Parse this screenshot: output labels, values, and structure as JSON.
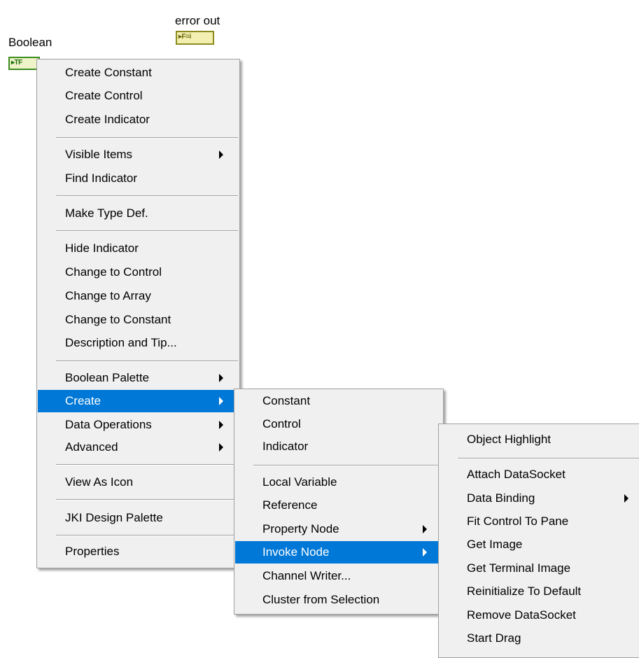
{
  "diagram": {
    "boolean_label": "Boolean",
    "boolean_glyph": "▸TF",
    "error_label": "error out",
    "error_glyph": "▸F≡i"
  },
  "menu1": {
    "items": [
      {
        "label": "Create Constant"
      },
      {
        "label": "Create Control"
      },
      {
        "label": "Create Indicator"
      },
      {
        "label": "Visible Items",
        "submenu": true
      },
      {
        "label": "Find Indicator"
      },
      {
        "label": "Make Type Def."
      },
      {
        "label": "Hide Indicator"
      },
      {
        "label": "Change to Control"
      },
      {
        "label": "Change to Array"
      },
      {
        "label": "Change to Constant"
      },
      {
        "label": "Description and Tip..."
      },
      {
        "label": "Boolean Palette",
        "submenu": true
      },
      {
        "label": "Create",
        "submenu": true,
        "selected": true
      },
      {
        "label": "Data Operations",
        "submenu": true
      },
      {
        "label": "Advanced",
        "submenu": true
      },
      {
        "label": "View As Icon"
      },
      {
        "label": "JKI Design Palette"
      },
      {
        "label": "Properties"
      }
    ]
  },
  "menu2": {
    "items": [
      {
        "label": "Constant"
      },
      {
        "label": "Control"
      },
      {
        "label": "Indicator"
      },
      {
        "label": "Local Variable"
      },
      {
        "label": "Reference"
      },
      {
        "label": "Property Node",
        "submenu": true
      },
      {
        "label": "Invoke Node",
        "submenu": true,
        "selected": true
      },
      {
        "label": "Channel Writer..."
      },
      {
        "label": "Cluster from Selection"
      }
    ]
  },
  "menu3": {
    "items": [
      {
        "label": "Object Highlight"
      },
      {
        "label": "Attach DataSocket"
      },
      {
        "label": "Data Binding",
        "submenu": true
      },
      {
        "label": "Fit Control To Pane"
      },
      {
        "label": "Get Image"
      },
      {
        "label": "Get Terminal Image"
      },
      {
        "label": "Reinitialize To Default"
      },
      {
        "label": "Remove DataSocket"
      },
      {
        "label": "Start Drag"
      }
    ]
  }
}
